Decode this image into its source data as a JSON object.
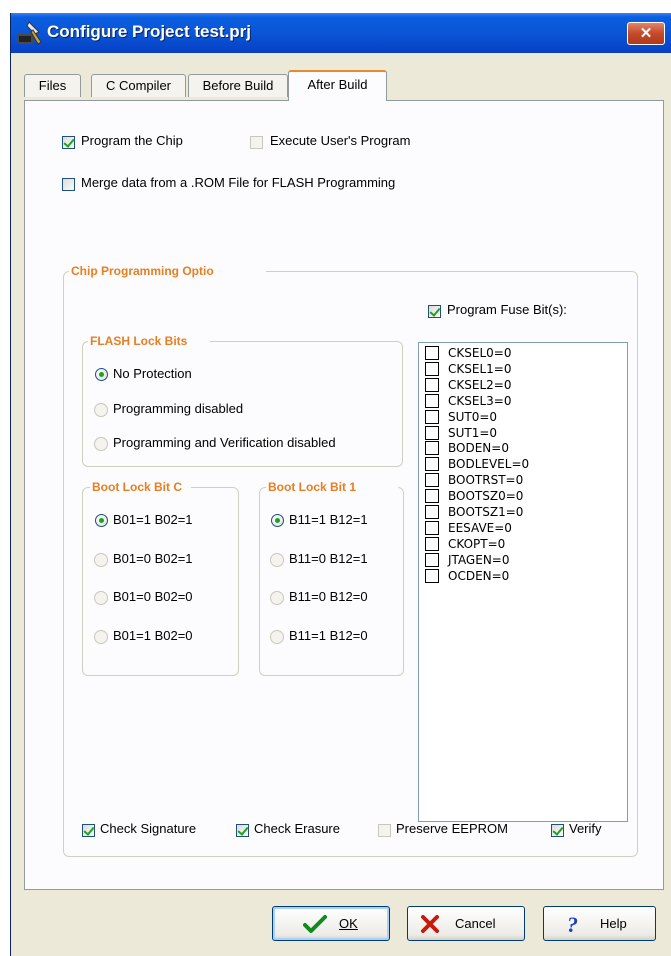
{
  "window": {
    "title": "Configure Project test.prj",
    "close_label": "✕"
  },
  "tabs": [
    {
      "label": "Files"
    },
    {
      "label": "C Compiler"
    },
    {
      "label": "Before Build"
    },
    {
      "label": "After Build"
    }
  ],
  "after_build": {
    "program_chip": {
      "label": "Program the Chip",
      "checked": true
    },
    "execute_program": {
      "label": "Execute User's Program",
      "checked": false
    },
    "merge_rom": {
      "label": "Merge data from a .ROM File for FLASH Programming",
      "checked": false
    }
  },
  "chip_options": {
    "title": "Chip Programming Optio",
    "program_fuse": {
      "label": "Program Fuse Bit(s):",
      "checked": true
    },
    "flash_lock": {
      "title": "FLASH Lock Bits",
      "options": [
        "No Protection",
        "Programming disabled",
        "Programming and Verification disabled"
      ],
      "selected": "No Protection"
    },
    "boot_lock_0": {
      "title": "Boot Lock Bit C",
      "options": [
        "B01=1 B02=1",
        "B01=0 B02=1",
        "B01=0 B02=0",
        "B01=1 B02=0"
      ],
      "selected": "B01=1 B02=1"
    },
    "boot_lock_1": {
      "title": "Boot Lock Bit 1",
      "options": [
        "B11=1 B12=1",
        "B11=0 B12=1",
        "B11=0 B12=0",
        "B11=1 B12=0"
      ],
      "selected": "B11=1 B12=1"
    },
    "fuse_bits": [
      "CKSEL0=0",
      "CKSEL1=0",
      "CKSEL2=0",
      "CKSEL3=0",
      "SUT0=0",
      "SUT1=0",
      "BODEN=0",
      "BODLEVEL=0",
      "BOOTRST=0",
      "BOOTSZ0=0",
      "BOOTSZ1=0",
      "EESAVE=0",
      "CKOPT=0",
      "JTAGEN=0",
      "OCDEN=0"
    ],
    "bottom_checks": {
      "check_signature": {
        "label": "Check Signature",
        "checked": true
      },
      "check_erasure": {
        "label": "Check Erasure",
        "checked": true
      },
      "preserve_eeprom": {
        "label": "Preserve EEPROM",
        "checked": false
      },
      "verify": {
        "label": "Verify",
        "checked": true
      }
    }
  },
  "buttons": {
    "ok": {
      "label": "OK",
      "icon": "checkmark-icon"
    },
    "cancel": {
      "label": "Cancel",
      "icon": "x-icon"
    },
    "help": {
      "label": "Help",
      "icon": "question-icon"
    }
  },
  "colors": {
    "accent_orange": "#e67e22",
    "check_green": "#21a121",
    "title_blue": "#0a56d6"
  }
}
